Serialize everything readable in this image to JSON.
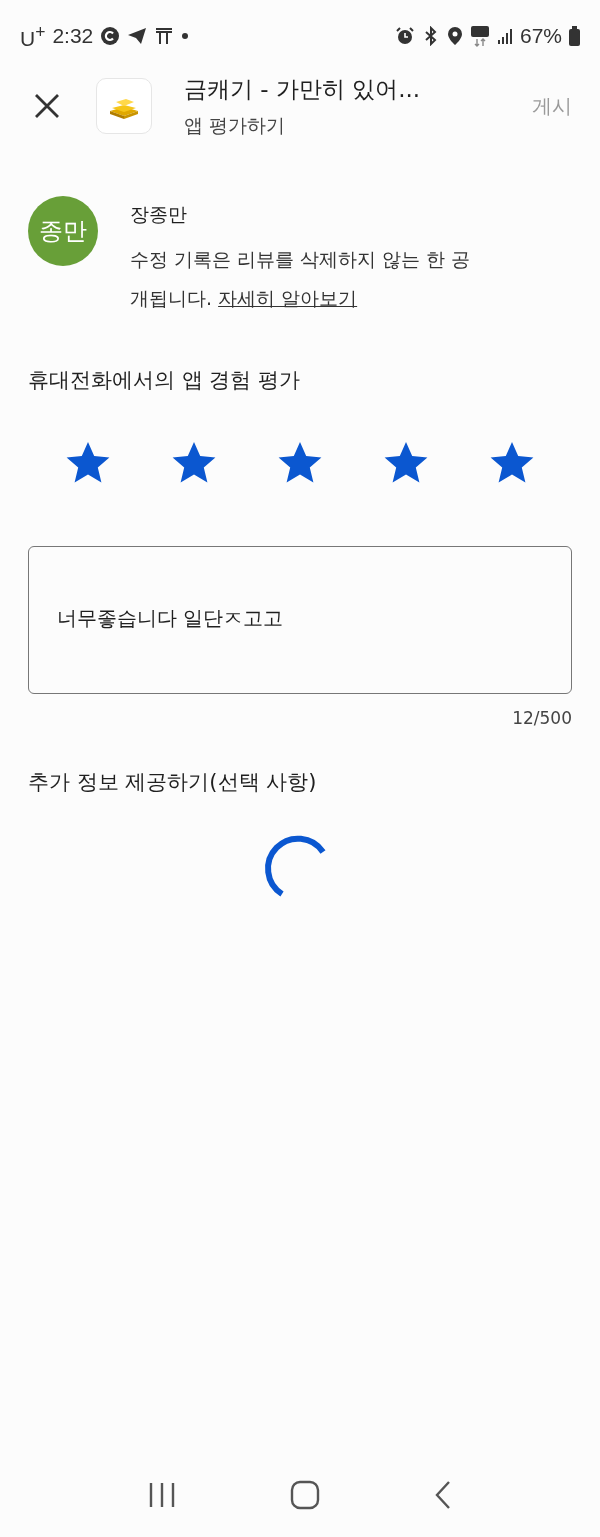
{
  "status_bar": {
    "carrier": "U$^{+}$",
    "time": "2:32",
    "battery": "67%"
  },
  "header": {
    "app_title": "금캐기 - 가만히 있어...",
    "subtitle": "앱 평가하기",
    "post_button": {
      "label": "게시",
      "disabled": true
    }
  },
  "user": {
    "avatar_text": "종만",
    "name": "장종만",
    "notice": "수정 기록은 리뷰를 삭제하지 않는 한 공개됩니다.",
    "learn_more_link": "자세히 알아보기"
  },
  "rating": {
    "title": "휴대전화에서의 앱 경험 평가",
    "stars": 5
  },
  "review": {
    "value": "너무좋습니다 일단ㅈ고고",
    "counter": "12/500"
  },
  "extra": {
    "title": "추가 정보 제공하기(선택 사항)"
  }
}
